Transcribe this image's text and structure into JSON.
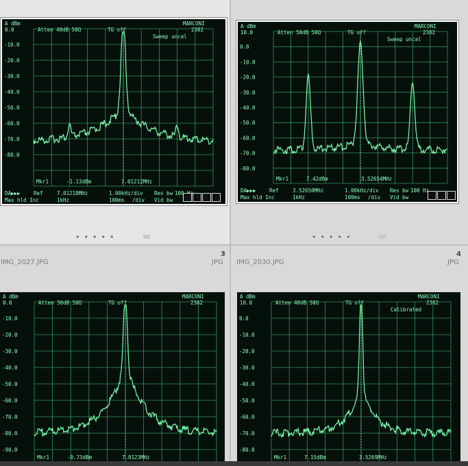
{
  "grid": {
    "cells": [
      {
        "index": "",
        "filename": "",
        "filetype": "",
        "selected": true,
        "screen": {
          "top": [
            "A dBm",
            "MARCONI"
          ],
          "line2": [
            "0.0",
            "Atten 40dB  50Ω",
            "TG off",
            "2382"
          ],
          "status": "Sweep uncal",
          "ylabels": [
            "-10.0",
            "-20.0",
            "-30.0",
            "-40.0",
            "-50.0",
            "-60.0",
            "-70.0",
            "-80.0"
          ],
          "mkr": [
            "Mkr1",
            "-1.13dBm",
            "7.01212MHz"
          ],
          "bottom1": [
            "DA▶▶▶",
            "Ref",
            "7.01210MHz",
            "1.00kHz/div",
            "Res bw",
            "100 Hz"
          ],
          "bottom2": [
            "Max hld Inc",
            "1kHz",
            "100ms",
            "/div",
            "Vid bw"
          ]
        }
      },
      {
        "index": "",
        "filename": "",
        "filetype": "",
        "selected": false,
        "screen": {
          "top": [
            "A dBm",
            "MARCONI"
          ],
          "line2": [
            "10.0",
            "Atten 50dB  50Ω",
            "TG off",
            "2382"
          ],
          "status": "Sweep uncal",
          "ylabels": [
            "0.0",
            "-10.0",
            "-20.0",
            "-30.0",
            "-40.0",
            "-50.0",
            "-60.0",
            "-70.0",
            "-80.0"
          ],
          "mkr": [
            "Mkr1",
            "7.42dBm",
            "3.52654MHz"
          ],
          "bottom1": [
            "DA▶▶▶",
            "Ref",
            "3.52650MHz",
            "1.00kHz/div",
            "Res bw",
            "100 Hz"
          ],
          "bottom2": [
            "Max hld Inc",
            "1kHz",
            "100ms",
            "/div",
            "Vid bw"
          ]
        }
      },
      {
        "index": "3",
        "filename": "IMG_2027.JPG",
        "filetype": "JPG",
        "selected": false,
        "screen": {
          "top": [
            "A dBm",
            "MARCONI"
          ],
          "line2": [
            "0.0",
            "Atten 30dB  50Ω",
            "TG off",
            "2382"
          ],
          "status": "",
          "ylabels": [
            "-10.0",
            "-20.0",
            "-30.0",
            "-40.0",
            "-50.0",
            "-60.0",
            "-70.0",
            "-80.0",
            "-90.0"
          ],
          "mkr": [
            "Mkr1",
            "-0.73dBm",
            "7.0123MHz"
          ],
          "bottom1": [],
          "bottom2": []
        }
      },
      {
        "index": "4",
        "filename": "IMG_2030.JPG",
        "filetype": "JPG",
        "selected": false,
        "screen": {
          "top": [
            "A dBm",
            "MARCONI"
          ],
          "line2": [
            "10.0",
            "Atten 40dB  50Ω",
            "TG off",
            "2382"
          ],
          "status": "Calibrated",
          "ylabels": [
            "0.0",
            "-10.0",
            "-20.0",
            "-30.0",
            "-40.0",
            "-50.0",
            "-60.0",
            "-70.0",
            "-80.0"
          ],
          "mkr": [
            "Mkr1",
            "7.15dBm",
            "3.5269MHz"
          ],
          "bottom1": [],
          "bottom2": []
        }
      }
    ]
  },
  "colors": {
    "trace": "#7dffb0",
    "grid": "#3fbf74",
    "text": "#8fffc0",
    "screen_bg": "#06100b"
  }
}
